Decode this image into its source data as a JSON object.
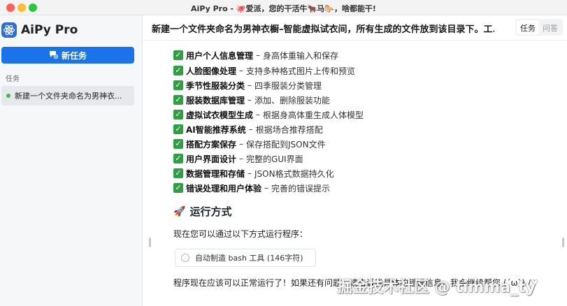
{
  "window": {
    "title": "AiPy Pro - 🐙爱派，您的干活牛🐂马🐎，啥都能干!"
  },
  "sidebar": {
    "app_name": "AiPy Pro",
    "new_task_label": "新任务",
    "section_label": "任务",
    "tasks": [
      {
        "label": "新建一个文件夹命名为男神衣..."
      }
    ]
  },
  "header": {
    "title": "新建一个文件夹命名为男神衣橱–智能虚拟试衣间，所有生成的文件放到该目录下。工...",
    "tabs": [
      {
        "label": "任务"
      },
      {
        "label": "问答"
      }
    ]
  },
  "content": {
    "features": [
      {
        "name": "用户个人信息管理",
        "sep": "–",
        "desc": "身高体重输入和保存"
      },
      {
        "name": "人脸图像处理",
        "sep": "–",
        "desc": "支持多种格式图片上传和预览"
      },
      {
        "name": "季节性服装分类",
        "sep": "–",
        "desc": "四季服装分类管理"
      },
      {
        "name": "服装数据库管理",
        "sep": "–",
        "desc": "添加、删除服装功能"
      },
      {
        "name": "虚拟试衣模型生成",
        "sep": "–",
        "desc": "根据身高体重生成人体模型"
      },
      {
        "name": "AI智能推荐系统",
        "sep": "–",
        "desc": "根据场合推荐搭配"
      },
      {
        "name": "搭配方案保存",
        "sep": "–",
        "desc": "保存搭配到JSON文件"
      },
      {
        "name": "用户界面设计",
        "sep": "–",
        "desc": "完整的GUI界面"
      },
      {
        "name": "数据管理和存储",
        "sep": "–",
        "desc": "JSON格式数据持久化"
      },
      {
        "name": "错误处理和用户体验",
        "sep": "–",
        "desc": "完善的错误提示"
      }
    ],
    "run_heading": "运行方式",
    "run_intro": "现在您可以通过以下方式运行程序：",
    "tool_call": "自动制造 bash 工具 (146字符)",
    "closing": "程序现在应该可以正常运行了！如果还有问题，请告诉我具体的错误信息，我会继续帮您 (´ω`) /♡"
  },
  "watermark": "掘金技术社区 @ timma_ty",
  "colors": {
    "accent": "#1a73e8",
    "check": "#2ea043",
    "status_dot": "#3fb950"
  }
}
